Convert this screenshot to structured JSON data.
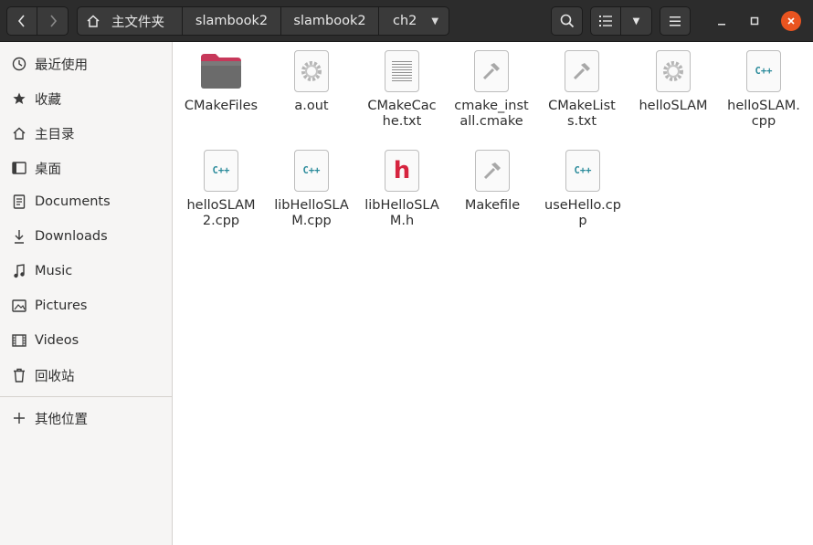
{
  "header": {
    "path": [
      "主文件夹",
      "slambook2",
      "slambook2",
      "ch2"
    ],
    "icons": {
      "back": "chevron-left-icon",
      "forward": "chevron-right-icon",
      "home": "home-icon",
      "search": "search-icon",
      "view": "list-view-icon",
      "menu": "hamburger-menu-icon",
      "close": "close-icon"
    }
  },
  "sidebar": {
    "items": [
      {
        "label": "最近使用",
        "icon": "clock-icon"
      },
      {
        "label": "收藏",
        "icon": "star-icon"
      },
      {
        "label": "主目录",
        "icon": "home-icon"
      },
      {
        "label": "桌面",
        "icon": "desktop-icon"
      },
      {
        "label": "Documents",
        "icon": "document-icon"
      },
      {
        "label": "Downloads",
        "icon": "download-icon"
      },
      {
        "label": "Music",
        "icon": "music-icon"
      },
      {
        "label": "Pictures",
        "icon": "picture-icon"
      },
      {
        "label": "Videos",
        "icon": "video-icon"
      },
      {
        "label": "回收站",
        "icon": "trash-icon"
      }
    ],
    "other_locations": {
      "label": "其他位置",
      "icon": "plus-icon"
    }
  },
  "files": [
    {
      "name": "CMakeFiles",
      "type": "folder"
    },
    {
      "name": "a.out",
      "type": "executable"
    },
    {
      "name": "CMakeCache.txt",
      "type": "text"
    },
    {
      "name": "cmake_install.cmake",
      "type": "script"
    },
    {
      "name": "CMakeLists.txt",
      "type": "script"
    },
    {
      "name": "helloSLAM",
      "type": "executable"
    },
    {
      "name": "helloSLAM.cpp",
      "type": "cpp"
    },
    {
      "name": "helloSLAM2.cpp",
      "type": "cpp"
    },
    {
      "name": "libHelloSLAM.cpp",
      "type": "cpp"
    },
    {
      "name": "libHelloSLAM.h",
      "type": "header"
    },
    {
      "name": "Makefile",
      "type": "script"
    },
    {
      "name": "useHello.cpp",
      "type": "cpp"
    }
  ],
  "icon_glyphs": {
    "cpp": "C++",
    "header": "h"
  },
  "colors": {
    "headerbar": "#2c2c2c",
    "accent_close": "#e95420",
    "folder": "#6b6b6b",
    "folder_tab": "#c7385a",
    "cpp_text": "#2b8b9b",
    "header_text": "#d6243f"
  }
}
